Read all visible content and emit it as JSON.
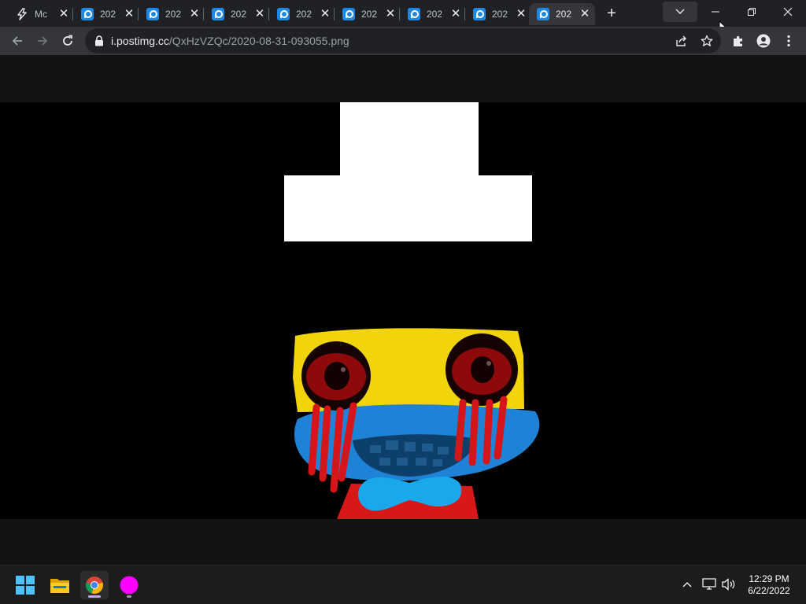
{
  "browser": {
    "tabs": [
      {
        "title": "Mc",
        "favicon": "bolt-icon",
        "active": false
      },
      {
        "title": "202",
        "favicon": "postimg-icon",
        "active": false
      },
      {
        "title": "202",
        "favicon": "postimg-icon",
        "active": false
      },
      {
        "title": "202",
        "favicon": "postimg-icon",
        "active": false
      },
      {
        "title": "202",
        "favicon": "postimg-icon",
        "active": false
      },
      {
        "title": "202",
        "favicon": "postimg-icon",
        "active": false
      },
      {
        "title": "202",
        "favicon": "postimg-icon",
        "active": false
      },
      {
        "title": "202",
        "favicon": "postimg-icon",
        "active": false
      },
      {
        "title": "202",
        "favicon": "postimg-icon",
        "active": true
      }
    ],
    "address": {
      "host": "i.postimg.cc",
      "path": "/QxHzVZQc/2020-08-31-093055.png"
    }
  },
  "taskbar": {
    "apps": [
      "windows-start-icon",
      "file-explorer-icon",
      "chrome-icon",
      "magenta-circle-app-icon"
    ],
    "tray": [
      "chevron-up-icon",
      "network-icon",
      "volume-icon"
    ],
    "clock": {
      "time": "12:29 PM",
      "date": "6/22/2022"
    }
  },
  "colors": {
    "titlebar": "#202124",
    "toolbar": "#35363a",
    "page_bg": "#131313",
    "canvas_bg": "#030000",
    "taskbar": "#1c1c1c",
    "face_yellow": "#f2d40a",
    "mouth_blue": "#1e82d6",
    "bowtie_blue": "#1aa8ec",
    "eye_red": "#8e0a0a",
    "tears_red": "#d4161a",
    "shirt_red": "#d81818"
  }
}
